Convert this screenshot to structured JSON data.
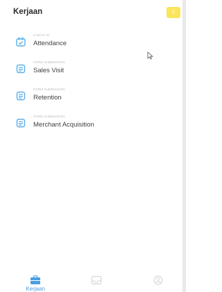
{
  "header": {
    "title": "Kerjaan",
    "notification_count": "2"
  },
  "menu": [
    {
      "sublabel": "CHECK IN",
      "label": "Attendance",
      "icon": "attendance-icon"
    },
    {
      "sublabel": "FORM SUBMISSION",
      "label": "Sales Visit",
      "icon": "form-icon"
    },
    {
      "sublabel": "FORM SUBMISSION",
      "label": "Retention",
      "icon": "form-icon"
    },
    {
      "sublabel": "FORM SUBMISSION",
      "label": "Merchant Acquisition",
      "icon": "form-icon"
    }
  ],
  "bottom_nav": {
    "active_label": "Kerjaan",
    "items": [
      {
        "icon": "briefcase-icon",
        "label": "Kerjaan",
        "active": true
      },
      {
        "icon": "inbox-icon",
        "active": false
      },
      {
        "icon": "profile-icon",
        "active": false
      }
    ]
  },
  "colors": {
    "accent": "#4a9fe0",
    "icon_blue": "#5aaee8",
    "badge_yellow": "#fbe55a",
    "inactive": "#d6d6d6"
  }
}
